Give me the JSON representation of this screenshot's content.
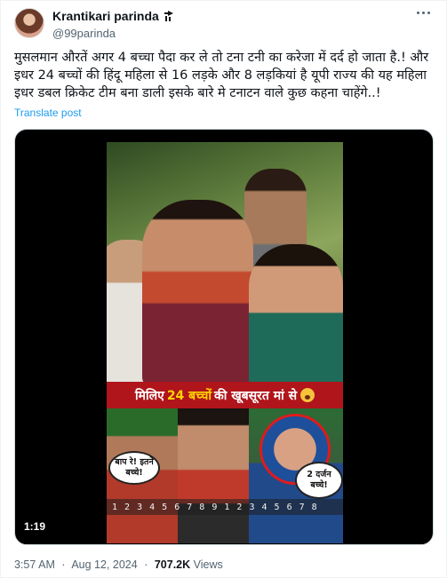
{
  "author": {
    "name": "Krantikari parinda",
    "handle": "@99parinda"
  },
  "tweet": {
    "line1": "मुसलमान औरतें अगर 4 बच्चा पैदा कर ले तो टना टनी का करेजा में दर्द हो जाता है.! और",
    "line2": "इधर 24 बच्चों की हिंदू महिला से 16 लड़के और 8 लड़कियां है यूपी राज्य की यह महिला",
    "line3": "इधर डबल क्रिकेट टीम बना डाली इसके बारे मे  टनाटन वाले कुछ कहना चाहेंगे..!",
    "translate_label": "Translate post"
  },
  "video": {
    "banner_prefix": "मिलिए",
    "banner_highlight": "24 बच्चों",
    "banner_suffix": "की खूबसूरत मां से",
    "bubble_left": "बाप रे! इतने बच्चे!",
    "bubble_right": "2 दर्जन बच्चे!",
    "numbers_strip": "1 2 3 4 5 6 7 8 9 1 2 3 4 5 6 7 8",
    "duration": "1:19"
  },
  "footer": {
    "time": "3:57 AM",
    "separator": "·",
    "date": "Aug 12, 2024",
    "views_count": "707.2K",
    "views_label": "Views"
  },
  "colors": {
    "link": "#1d9bf0",
    "secondary_text": "#536471",
    "banner_red": "#b0151b",
    "banner_yellow": "#ffd400"
  }
}
